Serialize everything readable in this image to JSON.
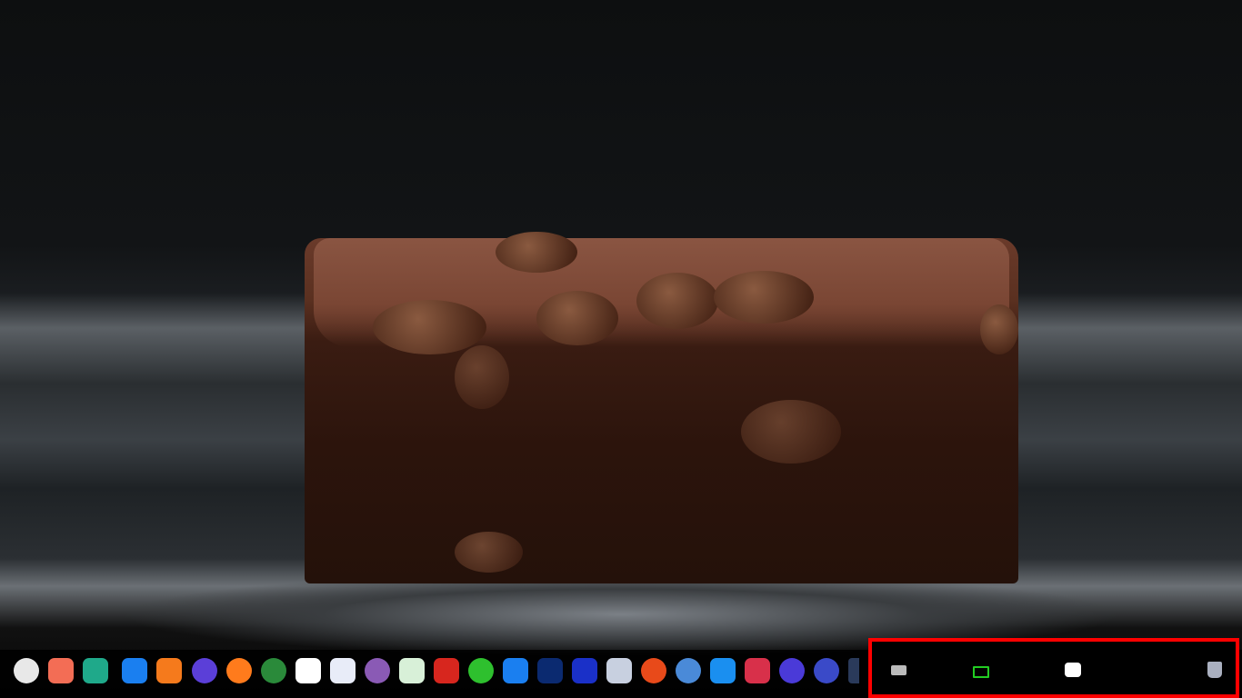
{
  "desktop": {
    "wallpaper": "brownie-with-walnuts"
  },
  "dock": {
    "apps": [
      {
        "name": "launcher-icon",
        "color": "#e8e8e8"
      },
      {
        "name": "multitasking-view-icon",
        "color": "#f36d55"
      },
      {
        "name": "show-desktop-icon",
        "color": "#1fa98a"
      },
      {
        "name": "app-store-icon",
        "color": "#1a7ff0"
      },
      {
        "name": "shopping-bag-icon",
        "color": "#f57a1c"
      },
      {
        "name": "browser-icon",
        "color": "#5b3fd8"
      },
      {
        "name": "firefox-icon",
        "color": "#ff7b1c"
      },
      {
        "name": "chrome-icon",
        "color": "#2a8a3a"
      },
      {
        "name": "baidu-netdisk-icon",
        "color": "#ffffff"
      },
      {
        "name": "feishu-icon",
        "color": "#e8ecf8"
      },
      {
        "name": "disk-utility-icon",
        "color": "#8a5ab5"
      },
      {
        "name": "music-download-icon",
        "color": "#d8f0d8"
      },
      {
        "name": "netease-music-icon",
        "color": "#d7261e"
      },
      {
        "name": "wechat-icon",
        "color": "#2ec02e"
      },
      {
        "name": "chat-bubble-icon",
        "color": "#1a7ff0"
      },
      {
        "name": "photoshop-icon",
        "color": "#0b2a70"
      },
      {
        "name": "audacity-icon",
        "color": "#1a30c8"
      },
      {
        "name": "document-viewer-icon",
        "color": "#c8d0e0"
      },
      {
        "name": "screen-recorder-icon",
        "color": "#e84a1a"
      },
      {
        "name": "remote-app-icon",
        "color": "#4a8ad8"
      },
      {
        "name": "downloader-icon",
        "color": "#1a8ff0"
      },
      {
        "name": "terminal-icon",
        "color": "#d8304a"
      },
      {
        "name": "system-monitor-icon",
        "color": "#4a3ad8"
      },
      {
        "name": "settings-icon",
        "color": "#3a4ac8"
      },
      {
        "name": "vscode-icon",
        "color": "#2a3a5a"
      }
    ],
    "tray": [
      {
        "name": "onscreen-keyboard-icon",
        "color": "#bbbbbb"
      },
      {
        "name": "screenshot-icon",
        "color": "#22cc22"
      },
      {
        "name": "input-method-icon",
        "color": "#ffffff"
      },
      {
        "name": "trash-icon",
        "color": "#aab0c0"
      }
    ],
    "highlight_color": "#ff0000"
  }
}
